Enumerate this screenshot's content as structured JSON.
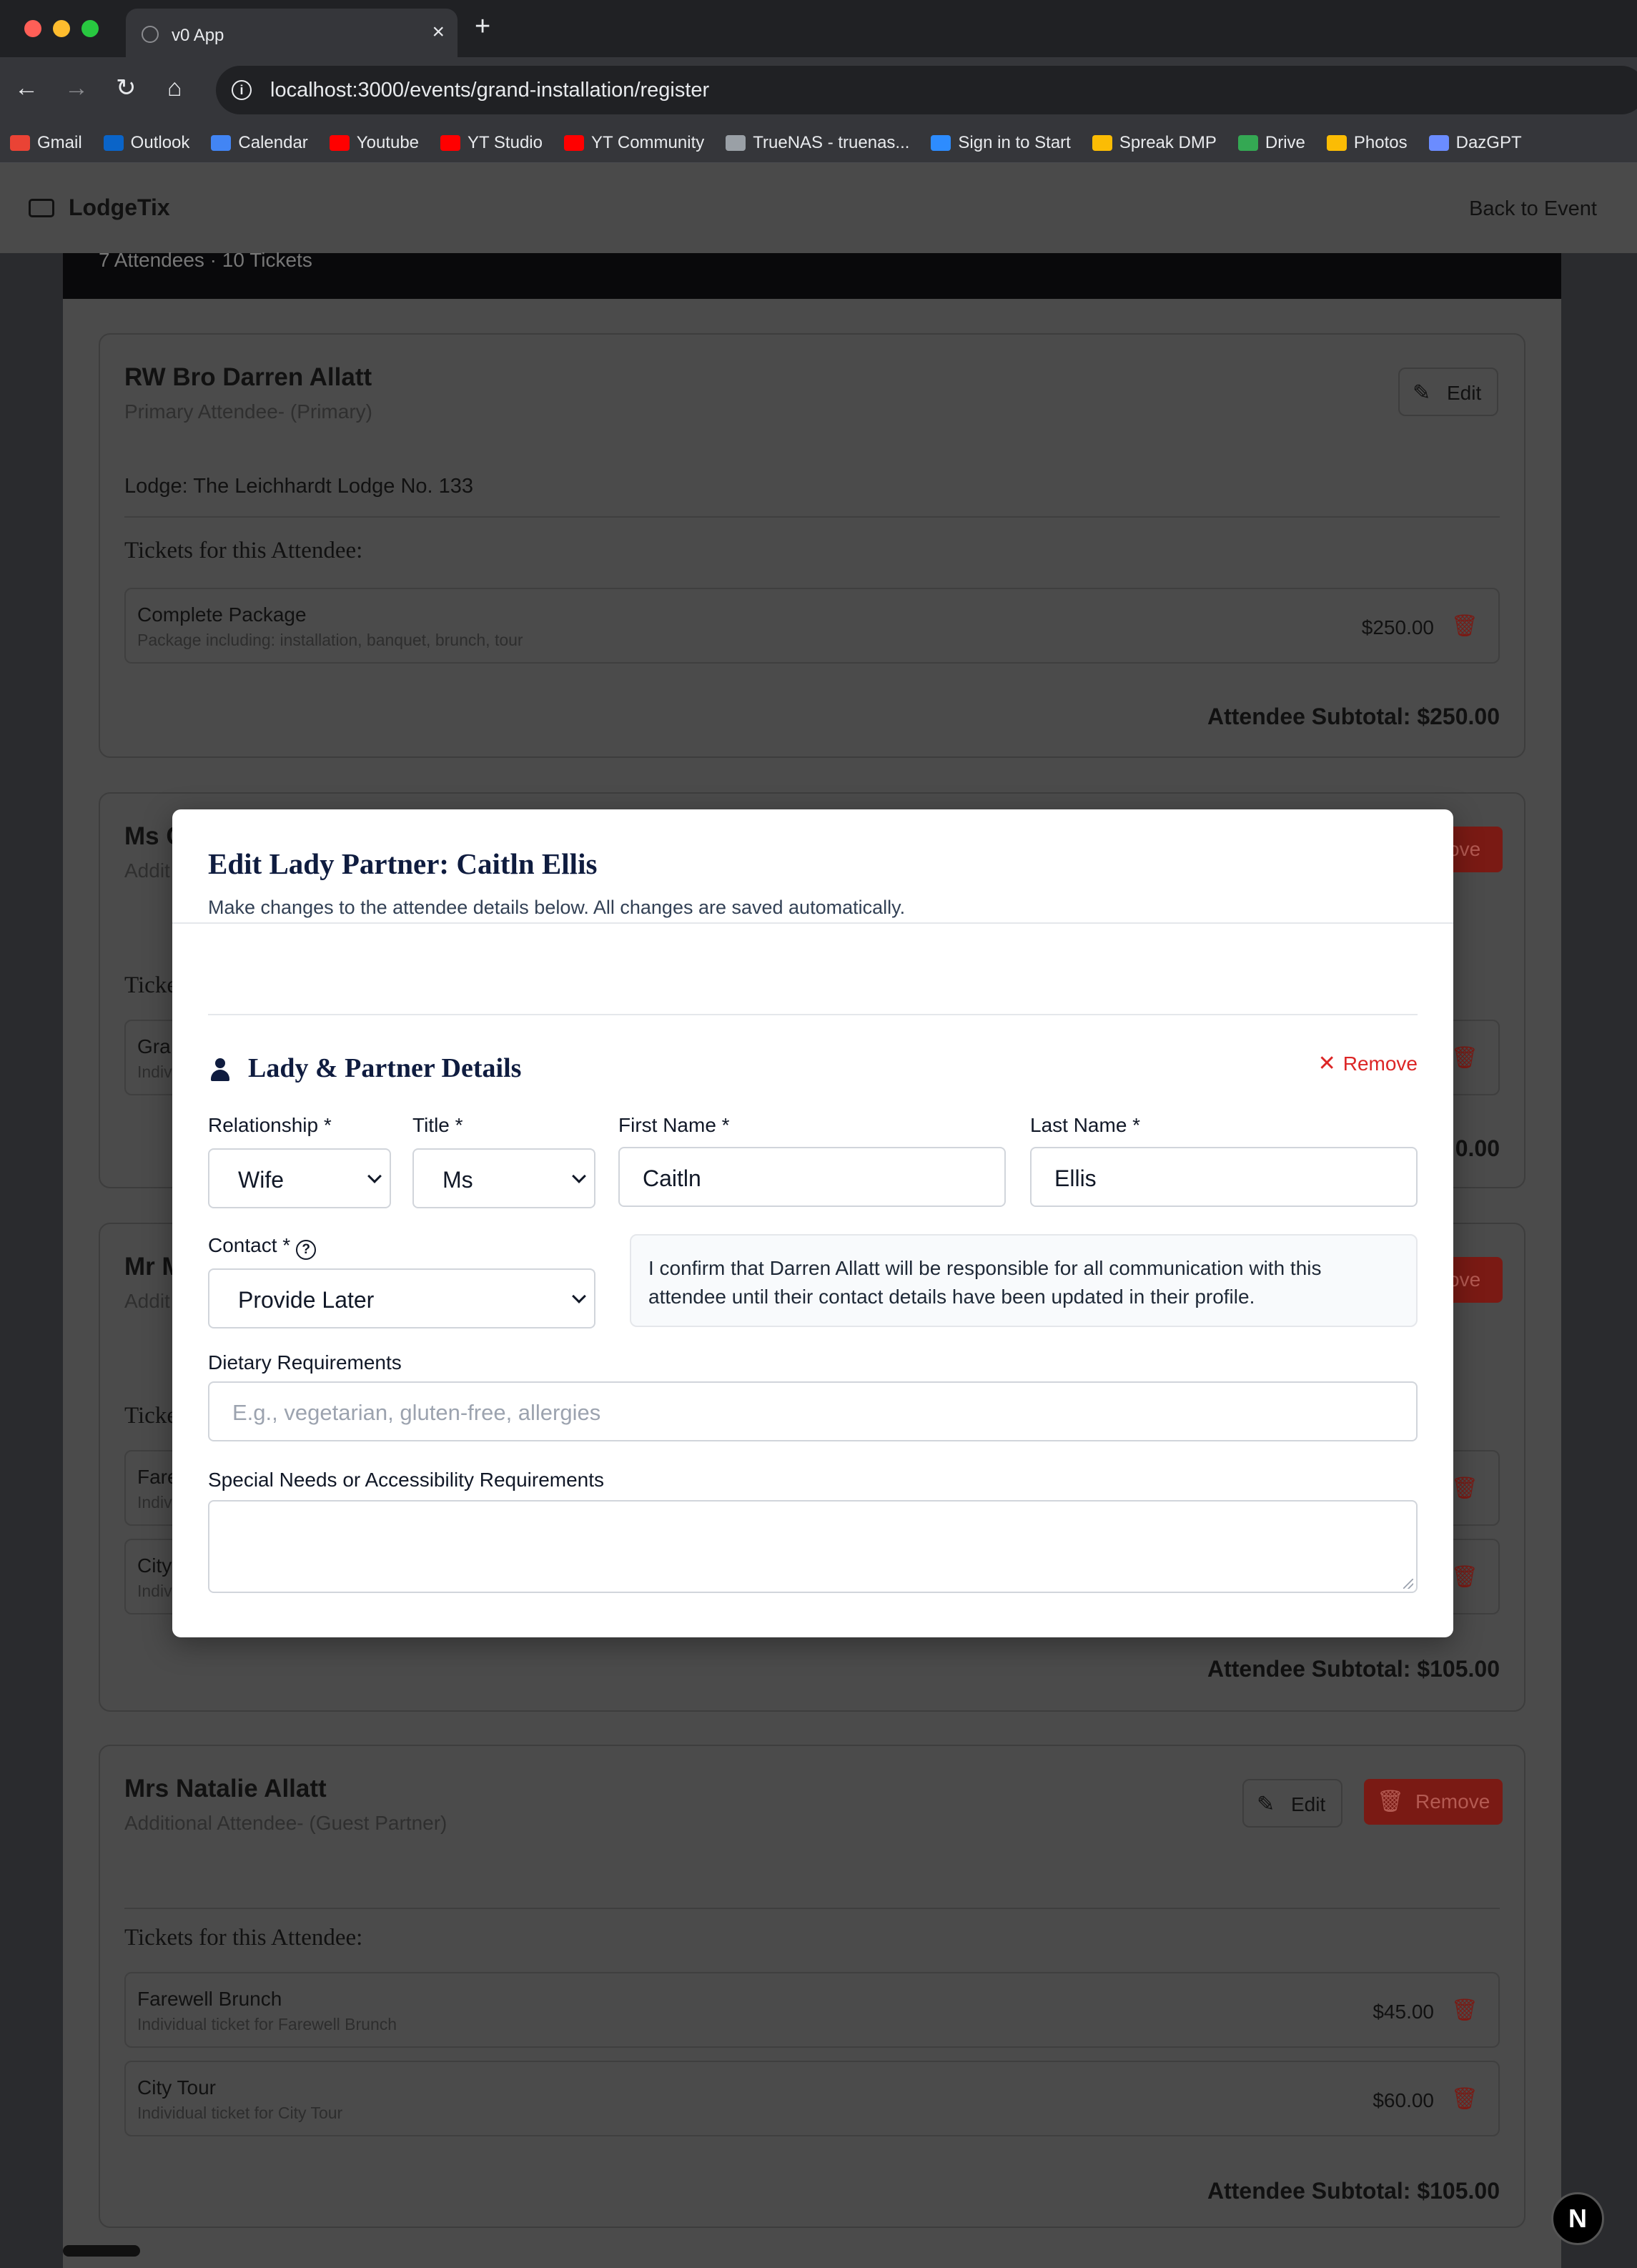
{
  "browser": {
    "tab_title": "v0 App",
    "url": "localhost:3000/events/grand-installation/register",
    "bookmarks": [
      {
        "label": "Gmail",
        "color": "#ea4335"
      },
      {
        "label": "Outlook",
        "color": "#0a64c8"
      },
      {
        "label": "Calendar",
        "color": "#4285f4"
      },
      {
        "label": "Youtube",
        "color": "#ff0000"
      },
      {
        "label": "YT Studio",
        "color": "#ff0000"
      },
      {
        "label": "YT Community",
        "color": "#ff0000"
      },
      {
        "label": "TrueNAS - truenas...",
        "color": "#9aa0a6"
      },
      {
        "label": "Sign in to Start",
        "color": "#2d8cff"
      },
      {
        "label": "Spreak DMP",
        "color": "#fbbc04"
      },
      {
        "label": "Drive",
        "color": "#34a853"
      },
      {
        "label": "Photos",
        "color": "#fbbc04"
      },
      {
        "label": "DazGPT",
        "color": "#6b8cff"
      }
    ]
  },
  "app": {
    "brand": "LodgeTix",
    "back_link": "Back to Event"
  },
  "page": {
    "summary": "7 Attendees · 10 Tickets",
    "tickets_heading": "Tickets for this Attendee:",
    "edit_label": "Edit",
    "remove_label": "Remove",
    "attendees": [
      {
        "name": "RW Bro Darren Allatt",
        "subtitle": "Primary Attendee- (Primary)",
        "lodge": "Lodge: The Leichhardt Lodge No. 133",
        "tickets": [
          {
            "name": "Complete Package",
            "desc": "Package including: installation, banquet, brunch, tour",
            "price": "$250.00"
          }
        ],
        "subtotal": "Attendee Subtotal: $250.00"
      },
      {
        "name": "Ms C",
        "subtitle": "Addit",
        "tickets": [
          {
            "name": "Gra",
            "desc": "Indiv"
          }
        ],
        "subtotal_tail": "0.00",
        "remove_tail": "ove"
      },
      {
        "name": "Mr M",
        "subtitle": "Addit",
        "tickets": [
          {
            "name": "Fare",
            "desc": "Indiv"
          },
          {
            "name": "City",
            "desc": "Indiv"
          }
        ],
        "subtotal": "Attendee Subtotal: $105.00",
        "remove_tail": "ove"
      },
      {
        "name": "Mrs Natalie Allatt",
        "subtitle": "Additional Attendee- (Guest Partner)",
        "tickets": [
          {
            "name": "Farewell Brunch",
            "desc": "Individual ticket for Farewell Brunch",
            "price": "$45.00"
          },
          {
            "name": "City Tour",
            "desc": "Individual ticket for City Tour",
            "price": "$60.00"
          }
        ],
        "subtotal": "Attendee Subtotal: $105.00"
      }
    ]
  },
  "modal": {
    "title": "Edit Lady Partner: Caitln Ellis",
    "description": "Make changes to the attendee details below. All changes are saved automatically.",
    "section_title": "Lady & Partner Details",
    "remove_label": "Remove",
    "fields": {
      "relationship": {
        "label": "Relationship *",
        "value": "Wife"
      },
      "title": {
        "label": "Title *",
        "value": "Ms"
      },
      "first_name": {
        "label": "First Name *",
        "value": "Caitln"
      },
      "last_name": {
        "label": "Last Name *",
        "value": "Ellis"
      },
      "contact": {
        "label": "Contact *",
        "value": "Provide Later"
      },
      "dietary": {
        "label": "Dietary Requirements",
        "placeholder": "E.g., vegetarian, gluten-free, allergies"
      },
      "special_needs": {
        "label": "Special Needs or Accessibility Requirements"
      }
    },
    "contact_notice": "I confirm that Darren Allatt will be responsible for all communication with this attendee until their contact details have been updated in their profile."
  },
  "icons": {
    "brand_icon": "ticket-icon",
    "remove_icon": "close-icon",
    "section_icon": "person-icon",
    "help_icon": "help-circle-icon",
    "trash_icon": "trash-icon",
    "edit_icon": "pencil-icon"
  },
  "colors": {
    "accent_navy": "#0f1c3f",
    "danger": "#dc2626"
  },
  "next_badge": "N"
}
